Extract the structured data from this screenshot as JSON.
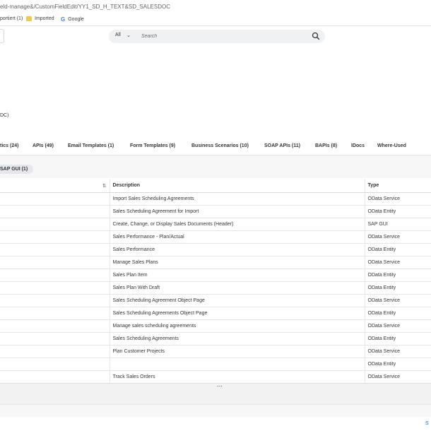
{
  "browser": {
    "url": "eld-manage&/CustomFieldEdit/YY1_SD_H_TEXT&SD_SALESDOC",
    "bookmarks": [
      {
        "label": "portiert (1)"
      },
      {
        "label": "Imported",
        "icon": "folder-icon"
      },
      {
        "label": "Google",
        "icon": "google-icon"
      }
    ]
  },
  "search": {
    "scope": "All",
    "placeholder": "Search"
  },
  "header": {
    "subtitle": "DC)"
  },
  "tabs": [
    {
      "label": "tics (24)"
    },
    {
      "label": "APIs (49)"
    },
    {
      "label": "Email Templates (1)"
    },
    {
      "label": "Form Templates (9)"
    },
    {
      "label": "Business Scenarios (10)"
    },
    {
      "label": "SOAP APIs (11)"
    },
    {
      "label": "BAPIs (8)"
    },
    {
      "label": "IDocs"
    },
    {
      "label": "Where-Used"
    }
  ],
  "filter": {
    "chip_label": "SAP GUI (1)"
  },
  "table": {
    "columns": [
      "",
      "Description",
      "Type"
    ],
    "rows": [
      {
        "name": "",
        "description": "Import Sales Scheduling Agreements",
        "type": "OData Service"
      },
      {
        "name": "",
        "description": "Sales Scheduling Agreement for Import",
        "type": "OData Entity"
      },
      {
        "name": "",
        "description": "Create, Change, or Display Sales Documents (Header)",
        "type": "SAP GUI"
      },
      {
        "name": "",
        "description": "Sales Performance - Plan/Actual",
        "type": "OData Service"
      },
      {
        "name": "",
        "description": "Sales Performance",
        "type": "OData Entity"
      },
      {
        "name": "",
        "description": "Manage Sales Plans",
        "type": "OData Service"
      },
      {
        "name": "",
        "description": "Sales Plan Item",
        "type": "OData Entity"
      },
      {
        "name": "",
        "description": "Sales Plan With Draft",
        "type": "OData Entity"
      },
      {
        "name": "",
        "description": "Sales Scheduling Agreement Object Page",
        "type": "OData Service"
      },
      {
        "name": "",
        "description": "Sales Scheduling Agreements Object Page",
        "type": "OData Entity"
      },
      {
        "name": "",
        "description": "Manage sales scheduling agreements",
        "type": "OData Service"
      },
      {
        "name": "",
        "description": "Sales Scheduling Agreements",
        "type": "OData Entity"
      },
      {
        "name": "",
        "description": "Plan Customer Projects",
        "type": "OData Service"
      },
      {
        "name": "",
        "description": "",
        "type": "OData Entity"
      },
      {
        "name": "",
        "description": "Track Sales Orders",
        "type": "OData Service"
      }
    ]
  },
  "footer": {
    "corner_text": "S"
  },
  "colors": {
    "accent": "#0a6ed1",
    "text": "#32363a",
    "search_bg": "#eff1f3"
  }
}
